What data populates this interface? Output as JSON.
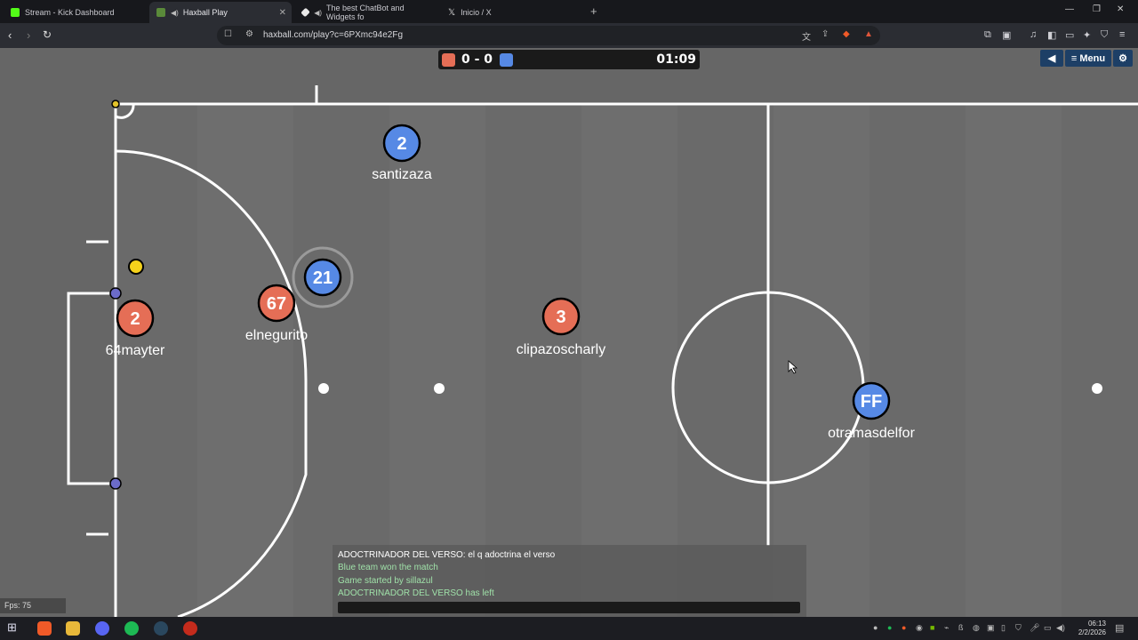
{
  "browser": {
    "tabs": [
      {
        "title": "Stream - Kick Dashboard",
        "color": "#53fc18"
      },
      {
        "title": "Haxball Play",
        "color": "#5a8a3a"
      },
      {
        "title": "The best ChatBot and Widgets fo",
        "color": "#e8e8e8"
      },
      {
        "title": "Inicio / X",
        "color": "#111111"
      }
    ],
    "url": "haxball.com/play?c=6PXmc94e2Fg"
  },
  "game": {
    "score": "0 - 0",
    "timer": "01:09",
    "red_color": "#e56e56",
    "blue_color": "#5689e5",
    "menu_label": "Menu",
    "fps_label": "Fps: 75",
    "players": [
      {
        "number": "2",
        "name": "santizaza",
        "team": "blue"
      },
      {
        "number": "21",
        "name": "",
        "team": "blue"
      },
      {
        "number": "67",
        "name": "elnegurito",
        "team": "red"
      },
      {
        "number": "2",
        "name": "64mayter",
        "team": "red"
      },
      {
        "number": "3",
        "name": "clipazoscharly",
        "team": "red"
      },
      {
        "number": "FF",
        "name": "otramasdelfor",
        "team": "blue"
      }
    ],
    "chat": [
      {
        "text": "ADOCTRINADOR DEL VERSO: el q adoctrina el verso",
        "color": "#ffffff"
      },
      {
        "text": "Blue team won the match",
        "color": "#9fe0a8"
      },
      {
        "text": "Game started by sillazul",
        "color": "#9fe0a8"
      },
      {
        "text": "ADOCTRINADOR DEL VERSO has left",
        "color": "#9fe0a8"
      }
    ]
  },
  "taskbar": {
    "time": "06:13",
    "date": "2/2/2026"
  }
}
